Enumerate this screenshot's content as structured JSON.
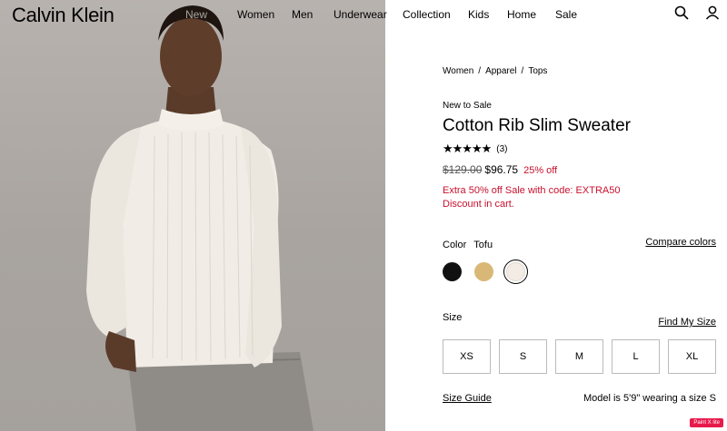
{
  "header": {
    "logo": "Calvin Klein",
    "nav": [
      "New",
      "Women",
      "Men",
      "Underwear",
      "Collection",
      "Kids",
      "Home",
      "Sale"
    ],
    "icons": [
      "search-icon",
      "account-icon"
    ]
  },
  "photo": {
    "description_icon": "model-photo"
  },
  "product": {
    "breadcrumb": [
      "Women",
      "Apparel",
      "Tops"
    ],
    "breadcrumb_sep": "/",
    "tag": "New to Sale",
    "title": "Cotton Rib Slim Sweater",
    "stars": "★★★★★",
    "rating_value": 5,
    "rating_count": "(3)",
    "original_price": "$129.00",
    "sale_price": "$96.75",
    "discount": "25% off",
    "promo_line1": "Extra 50% off Sale with code: EXTRA50",
    "promo_line2": "Discount in cart.",
    "color_label": "Color",
    "color_name": "Tofu",
    "compare_colors": "Compare colors",
    "swatches": [
      {
        "name": "black",
        "color": "#111111"
      },
      {
        "name": "tan",
        "color": "#d9b877"
      },
      {
        "name": "tofu",
        "color": "#f3ece4",
        "selected": true
      }
    ],
    "size_label": "Size",
    "find_my_size": "Find My Size",
    "sizes": [
      "XS",
      "S",
      "M",
      "L",
      "XL"
    ],
    "size_guide": "Size Guide",
    "model_info": "Model is 5'9\" wearing a size S"
  },
  "badge": "Paint X lite",
  "colors": {
    "sale_red": "#c8102e",
    "photo_bg": "#b0aba7"
  }
}
